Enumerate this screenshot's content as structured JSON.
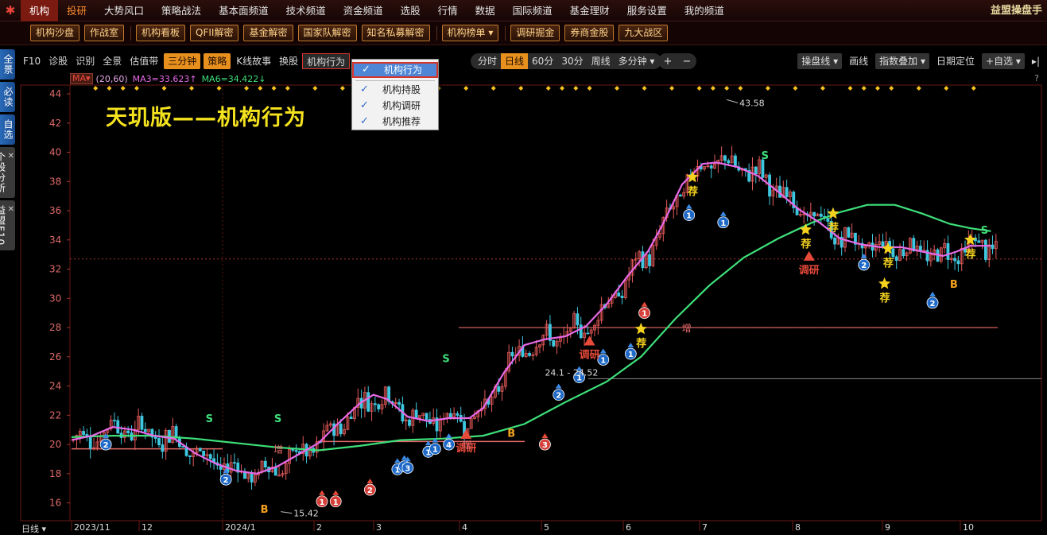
{
  "app": {
    "brand": "益盟操盘手",
    "logo_icon": "swirl-logo-icon"
  },
  "menu": [
    {
      "label": "机构",
      "state": "active"
    },
    {
      "label": "投研",
      "state": "accent"
    },
    {
      "label": "大势风口"
    },
    {
      "label": "策略战法"
    },
    {
      "label": "基本面频道"
    },
    {
      "label": "技术频道"
    },
    {
      "label": "资金频道"
    },
    {
      "label": "选股"
    },
    {
      "label": "行情"
    },
    {
      "label": "数据"
    },
    {
      "label": "国际频道"
    },
    {
      "label": "基金理财"
    },
    {
      "label": "服务设置"
    },
    {
      "label": "我的频道"
    }
  ],
  "toolbar2": {
    "groups": [
      [
        "机构沙盘",
        "作战室"
      ],
      [
        "机构看板",
        "QFII解密",
        "基金解密",
        "国家队解密",
        "知名私募解密"
      ],
      [
        "机构榜单 ▾"
      ],
      [
        "调研掘金",
        "券商金股",
        "九大战区"
      ]
    ]
  },
  "sidebar": {
    "tabs": [
      {
        "label": "全景",
        "closable": false
      },
      {
        "label": "必读",
        "closable": false
      },
      {
        "label": "自选",
        "closable": false
      },
      {
        "label": "个股分析",
        "closable": true
      },
      {
        "label": "益盟F10",
        "closable": true
      }
    ]
  },
  "ktoolbar": {
    "items": [
      {
        "label": "F10"
      },
      {
        "label": "诊股"
      },
      {
        "label": "识别"
      },
      {
        "label": "全景"
      },
      {
        "label": "估值带"
      },
      {
        "label": "三分钟",
        "style": "orange"
      },
      {
        "label": "策略",
        "style": "orange"
      },
      {
        "label": "K线故事"
      },
      {
        "label": "换股"
      },
      {
        "label": "机构行为",
        "style": "outlined"
      }
    ],
    "periods": [
      {
        "label": "分时"
      },
      {
        "label": "日线",
        "on": true
      },
      {
        "label": "60分"
      },
      {
        "label": "30分"
      },
      {
        "label": "周线"
      },
      {
        "label": "多分钟 ▾"
      }
    ],
    "zoom": {
      "plus": "+",
      "minus": "−"
    },
    "right": [
      {
        "label": "操盘线 ▾",
        "box": true
      },
      {
        "label": "画线"
      },
      {
        "label": "指数叠加 ▾",
        "box": true
      },
      {
        "label": "日期定位"
      },
      {
        "label": "+自选 ▾",
        "box": true
      },
      {
        "label": "▸|"
      }
    ]
  },
  "dropdown": {
    "items": [
      {
        "label": "机构行为",
        "checked": true,
        "selected": true
      },
      {
        "label": "机构持股",
        "checked": true
      },
      {
        "label": "机构调研",
        "checked": true
      },
      {
        "label": "机构推荐",
        "checked": true
      }
    ]
  },
  "ma": {
    "tag": "MA▾",
    "params": "(20,60)",
    "ma3": "MA3=33.623↑",
    "ma6": "MA6=34.422↓",
    "help": "?"
  },
  "overlay_title": "天玑版——机构行为",
  "bottom": {
    "period_label": "日线 ▾"
  },
  "colors": {
    "ma_pink": "#e86ae8",
    "ma_green": "#3ee07a",
    "up": "#e85a5a",
    "down": "#3ec8e0",
    "gold": "#f5d21e"
  },
  "chart_data": {
    "type": "candlestick",
    "y_ticks": [
      16,
      18,
      20,
      22,
      24,
      26,
      28,
      30,
      32,
      34,
      36,
      38,
      40,
      42,
      44
    ],
    "x_labels": [
      "2023/11",
      "12",
      "2024/1",
      "2",
      "3",
      "4",
      "5",
      "6",
      "7",
      "8",
      "9",
      "10"
    ],
    "ylim": [
      15,
      44.6
    ],
    "annotations": {
      "high": "43.58",
      "low": "15.42",
      "range_label": "24.1 - 24.52",
      "increase": "增",
      "research": "调研",
      "recommend": "荐",
      "buy": "B",
      "sell": "S"
    },
    "ma_short": [
      [
        0,
        20.3
      ],
      [
        6,
        20.6
      ],
      [
        12,
        21.2
      ],
      [
        18,
        21.0
      ],
      [
        24,
        20.6
      ],
      [
        30,
        20.4
      ],
      [
        36,
        19.4
      ],
      [
        42,
        18.7
      ],
      [
        48,
        18.2
      ],
      [
        54,
        18.0
      ],
      [
        60,
        18.5
      ],
      [
        66,
        19.3
      ],
      [
        72,
        20.1
      ],
      [
        78,
        21.5
      ],
      [
        84,
        22.8
      ],
      [
        88,
        23.4
      ],
      [
        92,
        23.1
      ],
      [
        98,
        21.9
      ],
      [
        104,
        21.6
      ],
      [
        110,
        21.8
      ],
      [
        116,
        21.8
      ],
      [
        120,
        22.5
      ],
      [
        126,
        24.9
      ],
      [
        132,
        26.8
      ],
      [
        138,
        27.2
      ],
      [
        144,
        27.4
      ],
      [
        150,
        28.1
      ],
      [
        156,
        29.6
      ],
      [
        162,
        31.5
      ],
      [
        168,
        33.2
      ],
      [
        172,
        34.9
      ],
      [
        178,
        37.8
      ],
      [
        184,
        39.2
      ],
      [
        188,
        39.3
      ],
      [
        194,
        39.0
      ],
      [
        200,
        38.4
      ],
      [
        206,
        37.3
      ],
      [
        212,
        36.1
      ],
      [
        218,
        35.2
      ],
      [
        224,
        34.1
      ],
      [
        230,
        33.7
      ],
      [
        236,
        33.5
      ],
      [
        242,
        33.5
      ],
      [
        248,
        33.2
      ],
      [
        254,
        32.9
      ],
      [
        258,
        33.2
      ],
      [
        262,
        33.6
      ],
      [
        268,
        33.6
      ]
    ],
    "ma_long": [
      [
        0,
        20.5
      ],
      [
        12,
        20.6
      ],
      [
        24,
        20.6
      ],
      [
        36,
        20.4
      ],
      [
        48,
        20.1
      ],
      [
        60,
        19.8
      ],
      [
        72,
        19.6
      ],
      [
        84,
        19.9
      ],
      [
        96,
        20.3
      ],
      [
        108,
        20.4
      ],
      [
        120,
        20.6
      ],
      [
        132,
        21.4
      ],
      [
        144,
        22.9
      ],
      [
        156,
        24.3
      ],
      [
        166,
        26.0
      ],
      [
        176,
        28.6
      ],
      [
        186,
        30.9
      ],
      [
        196,
        32.8
      ],
      [
        206,
        34.1
      ],
      [
        216,
        35.2
      ],
      [
        224,
        35.9
      ],
      [
        232,
        36.4
      ],
      [
        240,
        36.4
      ],
      [
        248,
        35.8
      ],
      [
        256,
        35.1
      ],
      [
        262,
        34.8
      ],
      [
        268,
        34.6
      ]
    ],
    "horizontal_levels": [
      19.7,
      20.2,
      28.0,
      24.5,
      32.7
    ],
    "buy_signals": [
      [
        56,
        15.6
      ],
      [
        128,
        20.8
      ],
      [
        257,
        31.0
      ]
    ],
    "sell_signals": [
      [
        40,
        21.8
      ],
      [
        60,
        21.8
      ],
      [
        109,
        25.9
      ],
      [
        202,
        39.8
      ],
      [
        266,
        34.7
      ]
    ],
    "research_marks": [
      [
        115,
        20.6
      ],
      [
        151,
        27.0
      ],
      [
        215,
        32.8
      ]
    ],
    "recommend_stars": [
      [
        181,
        38.3
      ],
      [
        214,
        34.7
      ],
      [
        222,
        35.8
      ],
      [
        238,
        33.4
      ],
      [
        237,
        31.0
      ],
      [
        262,
        34.0
      ],
      [
        166,
        27.9
      ]
    ],
    "institution_badges": [
      {
        "i": 10,
        "v": 20.0,
        "n": "2",
        "c": "blue"
      },
      {
        "i": 45,
        "v": 17.6,
        "n": "2",
        "c": "blue"
      },
      {
        "i": 73,
        "v": 16.1,
        "n": "1",
        "c": "red"
      },
      {
        "i": 77,
        "v": 16.1,
        "n": "1",
        "c": "red"
      },
      {
        "i": 87,
        "v": 16.9,
        "n": "2",
        "c": "red"
      },
      {
        "i": 95,
        "v": 18.3,
        "n": "1",
        "c": "blue"
      },
      {
        "i": 97,
        "v": 18.5,
        "n": "1",
        "c": "blue"
      },
      {
        "i": 98,
        "v": 18.4,
        "n": "3",
        "c": "blue"
      },
      {
        "i": 104,
        "v": 19.5,
        "n": "1",
        "c": "blue"
      },
      {
        "i": 106,
        "v": 19.7,
        "n": "1",
        "c": "blue"
      },
      {
        "i": 110,
        "v": 20.0,
        "n": "4",
        "c": "blue"
      },
      {
        "i": 138,
        "v": 20.0,
        "n": "3",
        "c": "red"
      },
      {
        "i": 142,
        "v": 23.4,
        "n": "2",
        "c": "blue"
      },
      {
        "i": 148,
        "v": 24.6,
        "n": "1",
        "c": "blue"
      },
      {
        "i": 155,
        "v": 25.8,
        "n": "1",
        "c": "blue"
      },
      {
        "i": 163,
        "v": 26.2,
        "n": "1",
        "c": "blue"
      },
      {
        "i": 167,
        "v": 29.0,
        "n": "1",
        "c": "red"
      },
      {
        "i": 180,
        "v": 35.7,
        "n": "1",
        "c": "blue"
      },
      {
        "i": 190,
        "v": 35.2,
        "n": "1",
        "c": "blue"
      },
      {
        "i": 231,
        "v": 32.3,
        "n": "2",
        "c": "blue"
      },
      {
        "i": 251,
        "v": 29.7,
        "n": "2",
        "c": "blue"
      }
    ]
  }
}
